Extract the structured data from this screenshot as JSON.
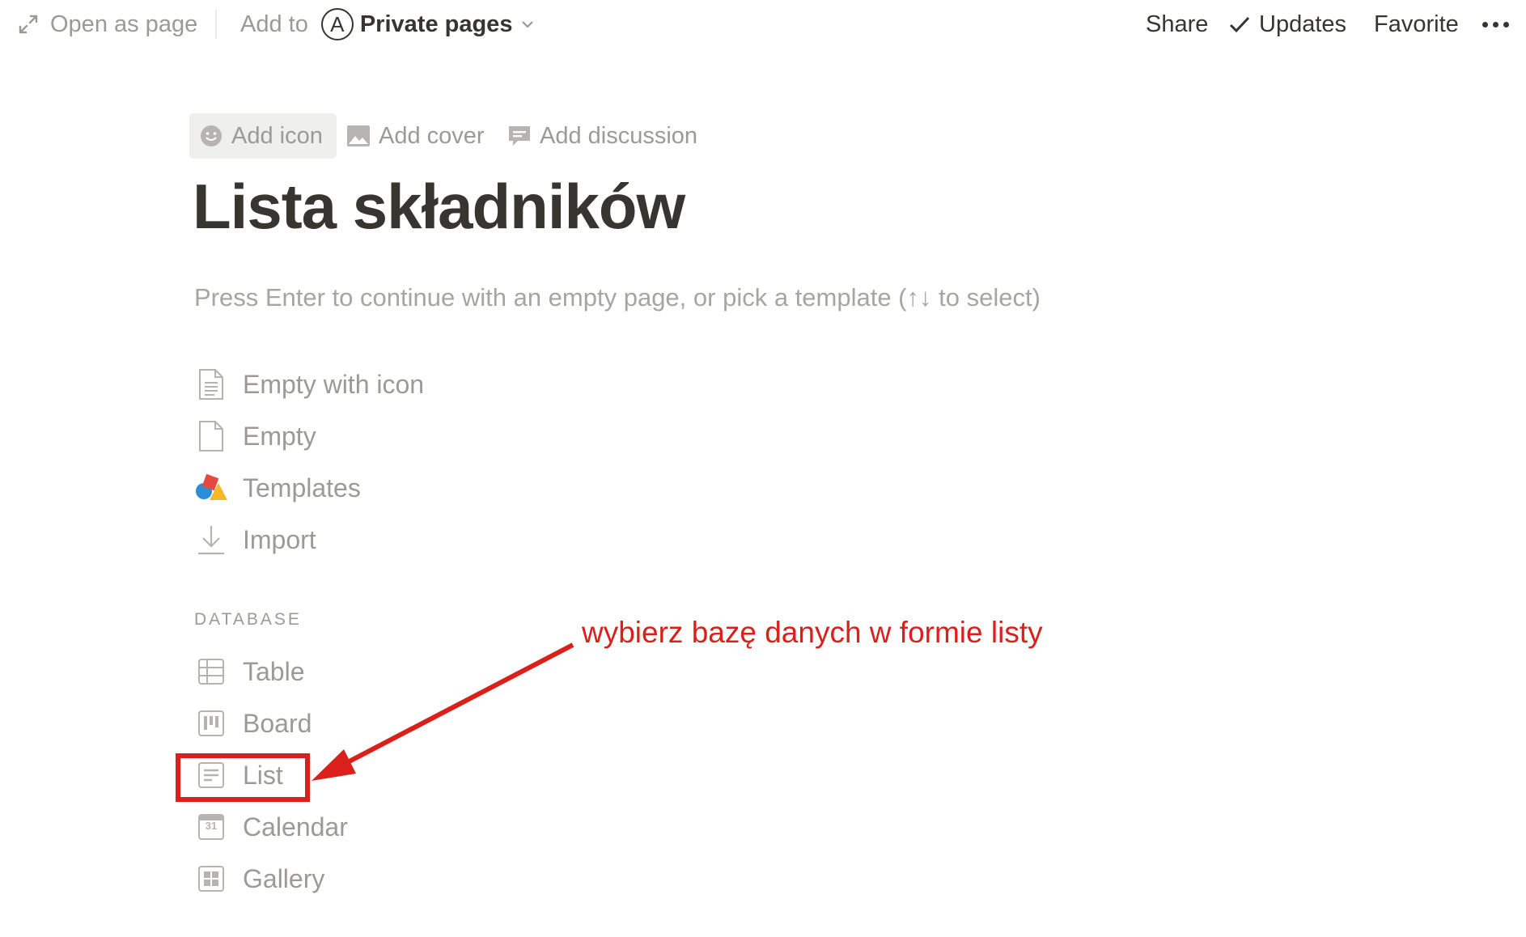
{
  "topbar": {
    "open_as_page": "Open as page",
    "add_to": "Add to",
    "workspace_initial": "A",
    "workspace_name": "Private pages",
    "share": "Share",
    "updates": "Updates",
    "favorite": "Favorite"
  },
  "page_controls": {
    "add_icon": "Add icon",
    "add_cover": "Add cover",
    "add_discussion": "Add discussion"
  },
  "page": {
    "title": "Lista składników",
    "hint": "Press Enter to continue with an empty page, or pick a template (↑↓ to select)"
  },
  "options": [
    {
      "label": "Empty with icon",
      "icon": "document-lines-icon"
    },
    {
      "label": "Empty",
      "icon": "document-icon"
    },
    {
      "label": "Templates",
      "icon": "templates-shapes-icon"
    },
    {
      "label": "Import",
      "icon": "download-icon"
    }
  ],
  "database": {
    "heading": "DATABASE",
    "items": [
      {
        "label": "Table",
        "icon": "table-icon"
      },
      {
        "label": "Board",
        "icon": "board-icon"
      },
      {
        "label": "List",
        "icon": "list-icon"
      },
      {
        "label": "Calendar",
        "icon": "calendar-icon",
        "icon_text": "31"
      },
      {
        "label": "Gallery",
        "icon": "gallery-icon"
      }
    ]
  },
  "annotation": {
    "text": "wybierz bazę danych w formie listy",
    "color": "#d9201b"
  }
}
